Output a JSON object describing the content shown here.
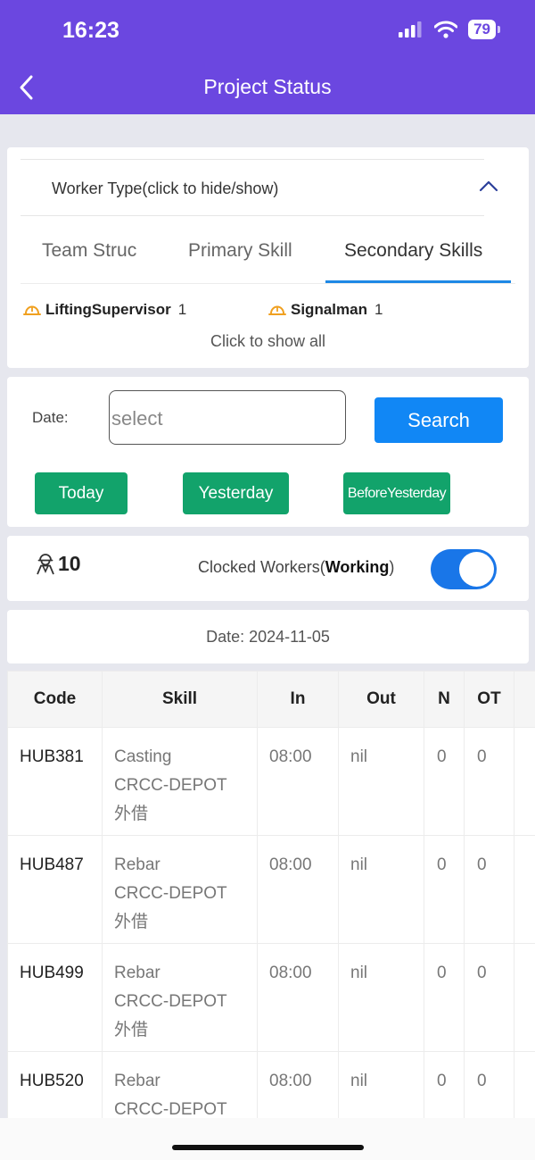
{
  "status_bar": {
    "time": "16:23",
    "battery": "79"
  },
  "header": {
    "title": "Project Status"
  },
  "worker_type": {
    "label": "Worker Type(click to hide/show)",
    "tabs": [
      "Team Struc",
      "Primary Skill",
      "Secondary Skills"
    ],
    "active_tab": "Secondary Skills",
    "skills": [
      {
        "name": "LiftingSupervisor",
        "count": "1"
      },
      {
        "name": "Signalman",
        "count": "1"
      }
    ],
    "show_all": "Click to show all"
  },
  "filter": {
    "date_label": "Date:",
    "date_placeholder": "select",
    "search_label": "Search",
    "quick_dates": [
      "Today",
      "Yesterday",
      "BeforeYesterday"
    ]
  },
  "summary": {
    "worker_count": "10",
    "clocked_prefix": "Clocked Workers(",
    "clocked_bold": "Working",
    "clocked_suffix": ")",
    "toggle_on": true
  },
  "date_display": "Date: 2024-11-05",
  "table": {
    "headers": [
      "Code",
      "Skill",
      "In",
      "Out",
      "N",
      "OT"
    ],
    "rows": [
      {
        "code": "HUB381",
        "skill": "Casting",
        "team": "CRCC-DEPOT",
        "note": "外借",
        "in": "08:00",
        "out": "nil",
        "n": "0",
        "ot": "0"
      },
      {
        "code": "HUB487",
        "skill": "Rebar",
        "team": "CRCC-DEPOT",
        "note": "外借",
        "in": "08:00",
        "out": "nil",
        "n": "0",
        "ot": "0"
      },
      {
        "code": "HUB499",
        "skill": "Rebar",
        "team": "CRCC-DEPOT",
        "note": "外借",
        "in": "08:00",
        "out": "nil",
        "n": "0",
        "ot": "0"
      },
      {
        "code": "HUB520",
        "skill": "Rebar",
        "team": "CRCC-DEPOT",
        "note": "",
        "in": "08:00",
        "out": "nil",
        "n": "0",
        "ot": "0"
      }
    ]
  },
  "colors": {
    "header": "#6b47e0",
    "primary": "#1187f5",
    "green": "#12a36b",
    "helmet": "#f0a020"
  }
}
